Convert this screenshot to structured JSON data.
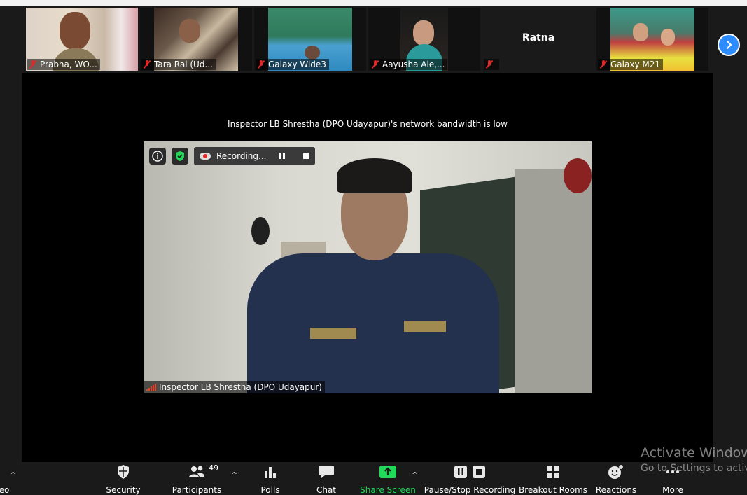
{
  "thumbnails": [
    {
      "name": "Prabha, WO..."
    },
    {
      "name": "Tara Rai (Ud..."
    },
    {
      "name": "Galaxy Wide3"
    },
    {
      "name": "Aayusha Ale,..."
    },
    {
      "name": "",
      "center_name": "Ratna"
    },
    {
      "name": "Galaxy M21"
    }
  ],
  "notice": "Inspector LB Shrestha (DPO Udayapur)'s network bandwidth is low",
  "video": {
    "recording_label": "Recording...",
    "speaker_name": "Inspector LB Shrestha (DPO Udayapur)"
  },
  "toolbar": {
    "video_partial": "eo",
    "security": "Security",
    "participants": "Participants",
    "participants_count": "49",
    "polls": "Polls",
    "chat": "Chat",
    "share_screen": "Share Screen",
    "pause_stop_recording": "Pause/Stop Recording",
    "breakout_rooms": "Breakout Rooms",
    "reactions": "Reactions",
    "more": "More"
  },
  "watermark": {
    "line1": "Activate Windows",
    "line2": "Go to Settings to activa"
  },
  "colors": {
    "share_green": "#23d959",
    "accent_blue": "#2d8cff",
    "muted_red": "#e02828"
  }
}
